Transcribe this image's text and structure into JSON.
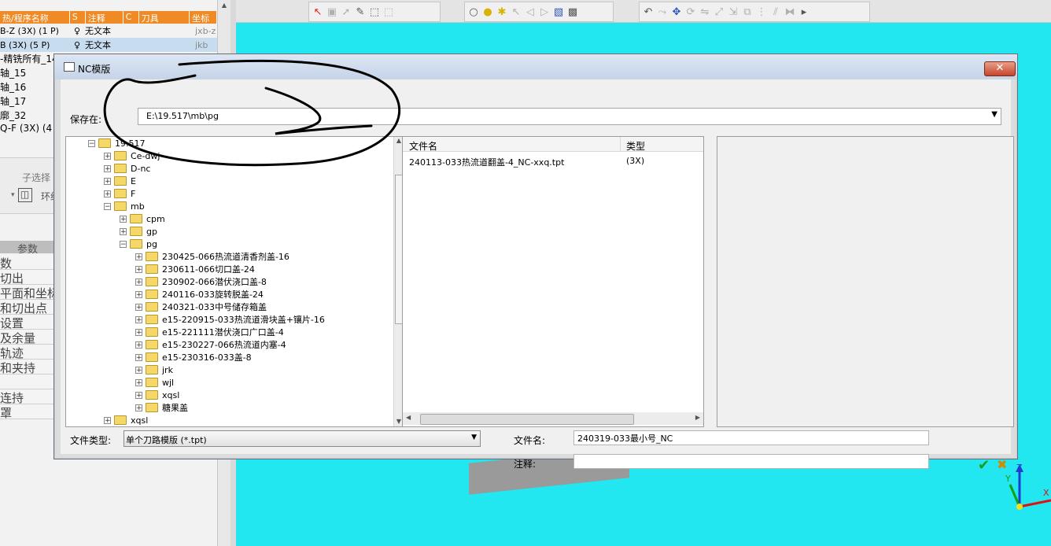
{
  "background_app": {
    "grid_header": [
      "热/程序名称",
      "S",
      "注释",
      "C",
      "刀具",
      "坐标"
    ],
    "grid_rows": [
      {
        "name": "B-Z (3X) (1 P)",
        "note": "无文本",
        "tool": "jxb-z",
        "selected": false
      },
      {
        "name": "B (3X) (5 P)",
        "note": "无文本",
        "tool": "jkb",
        "selected": true
      }
    ],
    "tree_lines": [
      "-精铣所有_14",
      "轴_15",
      "轴_16",
      "轴_17",
      "廓_32",
      "Q-F (3X) (4 P"
    ],
    "subselect_label": "子选择",
    "subselect_text": "环约",
    "param_header": "参数",
    "param_rows": [
      "数",
      "切出",
      "平面和坐标",
      "和切出点",
      "设置",
      "及余量",
      "轨迹",
      "和夹持",
      "",
      "连持",
      "罩"
    ]
  },
  "axis": {
    "x": "X",
    "y": "Y",
    "z": "Z"
  },
  "dialog": {
    "title": "NC模版",
    "close": "✕",
    "save_in_label": "保存在:",
    "save_in_value": "E:\\19.517\\mb\\pg",
    "tree": [
      {
        "label": "19.517",
        "level": 0,
        "expander": "−"
      },
      {
        "label": "Ce-dwj",
        "level": 1,
        "expander": "+"
      },
      {
        "label": "D-nc",
        "level": 1,
        "expander": "+"
      },
      {
        "label": "E",
        "level": 1,
        "expander": "+"
      },
      {
        "label": "F",
        "level": 1,
        "expander": "+"
      },
      {
        "label": "mb",
        "level": 1,
        "expander": "−"
      },
      {
        "label": "cpm",
        "level": 2,
        "expander": "+"
      },
      {
        "label": "gp",
        "level": 2,
        "expander": "+"
      },
      {
        "label": "pg",
        "level": 2,
        "expander": "−"
      },
      {
        "label": "230425-066热流道清香剂盖-16",
        "level": 3,
        "expander": "+"
      },
      {
        "label": "230611-066切口盖-24",
        "level": 3,
        "expander": "+"
      },
      {
        "label": "230902-066潜伏浇口盖-8",
        "level": 3,
        "expander": "+"
      },
      {
        "label": "240116-033旋转脱盖-24",
        "level": 3,
        "expander": "+"
      },
      {
        "label": "240321-033中号储存箱盖",
        "level": 3,
        "expander": "+"
      },
      {
        "label": "e15-220915-033热流道滑块盖+镶片-16",
        "level": 3,
        "expander": "+"
      },
      {
        "label": "e15-221111潜伏浇口广口盖-4",
        "level": 3,
        "expander": "+"
      },
      {
        "label": "e15-230227-066热流道内塞-4",
        "level": 3,
        "expander": "+"
      },
      {
        "label": "e15-230316-033盖-8",
        "level": 3,
        "expander": "+"
      },
      {
        "label": "jrk",
        "level": 3,
        "expander": "+"
      },
      {
        "label": "wjl",
        "level": 3,
        "expander": "+"
      },
      {
        "label": "xqsl",
        "level": 3,
        "expander": "+"
      },
      {
        "label": "糖果盖",
        "level": 3,
        "expander": "+"
      },
      {
        "label": "xqsl",
        "level": 1,
        "expander": "+"
      }
    ],
    "files_columns": [
      "文件名",
      "类型"
    ],
    "files": [
      {
        "name": "240113-033热流道翻盖-4_NC-xxq.tpt",
        "type": "(3X)"
      }
    ],
    "file_type_label": "文件类型:",
    "file_type_value": "单个刀路模版 (*.tpt)",
    "file_name_label": "文件名:",
    "file_name_value": "240319-033最小号_NC",
    "note_label": "注释:",
    "note_value": "",
    "ok": "✔",
    "cancel": "✖"
  }
}
